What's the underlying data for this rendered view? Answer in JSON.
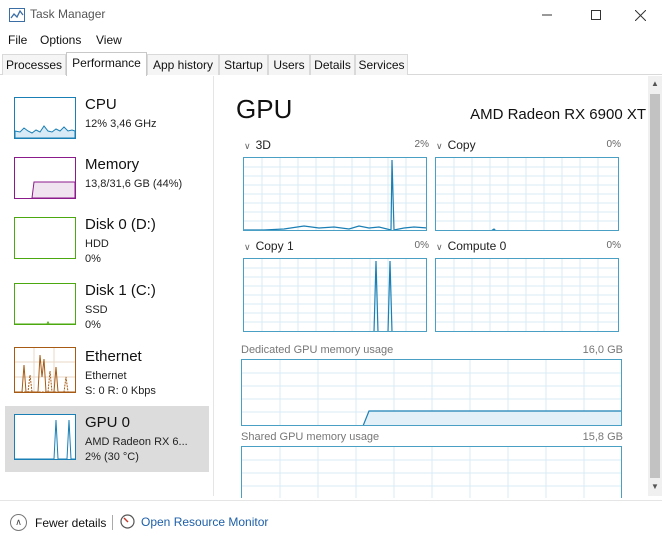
{
  "window": {
    "title": "Task Manager"
  },
  "colors": {
    "cpu": "#1a7fb5",
    "memory": "#8b1a8b",
    "disk": "#4ca80f",
    "ethernet": "#a75a14",
    "gpu": "#1a7fb5"
  },
  "menu": [
    "File",
    "Options",
    "View"
  ],
  "tabs": [
    {
      "label": "Processes"
    },
    {
      "label": "Performance",
      "active": true
    },
    {
      "label": "App history"
    },
    {
      "label": "Startup"
    },
    {
      "label": "Users"
    },
    {
      "label": "Details"
    },
    {
      "label": "Services"
    }
  ],
  "resources": [
    {
      "name": "CPU",
      "sub1": "12%  3,46 GHz",
      "sub2": "",
      "icon": "cpu-graph"
    },
    {
      "name": "Memory",
      "sub1": "13,8/31,6 GB (44%)",
      "sub2": "",
      "icon": "memory-graph"
    },
    {
      "name": "Disk 0 (D:)",
      "sub1": "HDD",
      "sub2": "0%",
      "icon": "disk-graph"
    },
    {
      "name": "Disk 1 (C:)",
      "sub1": "SSD",
      "sub2": "0%",
      "icon": "disk-graph"
    },
    {
      "name": "Ethernet",
      "sub1": "Ethernet",
      "sub2": "S: 0  R: 0 Kbps",
      "icon": "ethernet-graph"
    },
    {
      "name": "GPU 0",
      "sub1": "AMD Radeon RX 6...",
      "sub2": "2%  (30 °C)",
      "icon": "gpu-graph",
      "selected": true
    }
  ],
  "gpu": {
    "title": "GPU",
    "model": "AMD Radeon RX 6900 XT",
    "engines": [
      {
        "label": "3D",
        "percent": "2%"
      },
      {
        "label": "Copy",
        "percent": "0%"
      },
      {
        "label": "Copy 1",
        "percent": "0%"
      },
      {
        "label": "Compute 0",
        "percent": "0%"
      }
    ],
    "dedicated": {
      "label": "Dedicated GPU memory usage",
      "max": "16,0 GB"
    },
    "shared": {
      "label": "Shared GPU memory usage",
      "max": "15,8 GB"
    }
  },
  "footer": {
    "fewer_details": "Fewer details",
    "open_monitor": "Open Resource Monitor"
  }
}
